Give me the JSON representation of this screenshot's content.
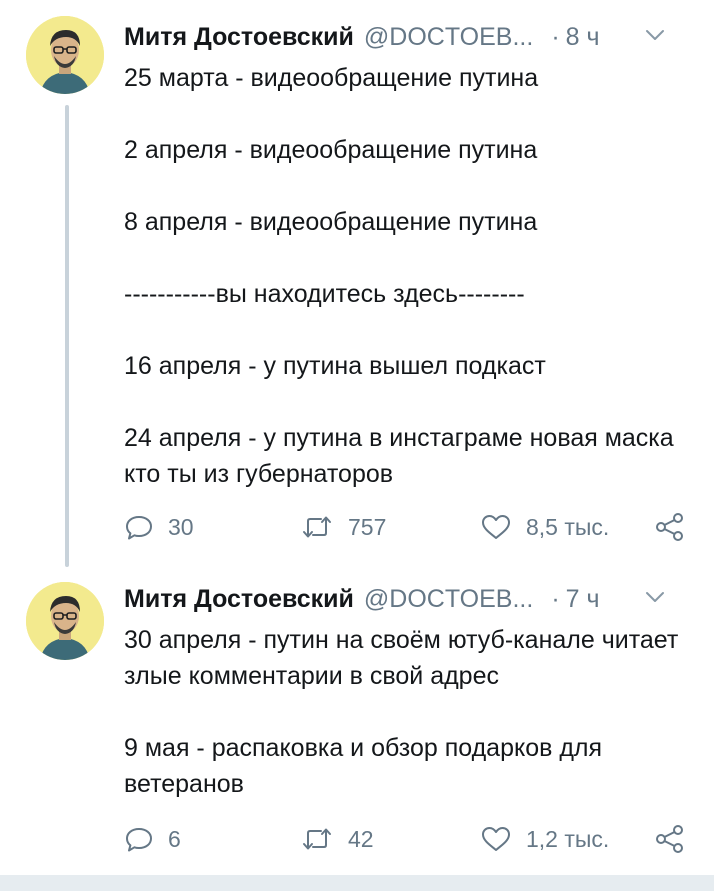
{
  "tweets": [
    {
      "author_name": "Митя Достоевский",
      "handle": "@DOCTOEB...",
      "time_separator": "·",
      "time": "8 ч",
      "paragraphs": [
        "25 марта - видеообращение путина",
        "2 апреля - видеообращение путина",
        "8 апреля - видеообращение путина",
        "-----------вы находитесь здесь--------",
        "16 апреля - у путина вышел подкаст",
        "24 апреля - у путина в инстаграме новая маска кто ты из губернаторов"
      ],
      "replies": "30",
      "retweets": "757",
      "likes": "8,5 тыс.",
      "has_thread_line": true
    },
    {
      "author_name": "Митя Достоевский",
      "handle": "@DOCTOEB...",
      "time_separator": "·",
      "time": "7 ч",
      "paragraphs": [
        "30 апреля - путин на своём ютуб-канале читает злые комментарии в свой адрес",
        "9 мая - распаковка и обзор подарков для ветеранов"
      ],
      "replies": "6",
      "retweets": "42",
      "likes": "1,2 тыс.",
      "has_thread_line": false
    }
  ],
  "icons": {
    "reply": "reply-icon",
    "retweet": "retweet-icon",
    "like": "heart-icon",
    "share": "share-icon",
    "more": "chevron-down-icon",
    "avatar": "avatar"
  },
  "colors": {
    "text": "#14171a",
    "secondary": "#657786",
    "thread_line": "#c8d2da",
    "avatar_bg": "#f3ea8e",
    "bottom_bar": "#e6ecf0"
  }
}
